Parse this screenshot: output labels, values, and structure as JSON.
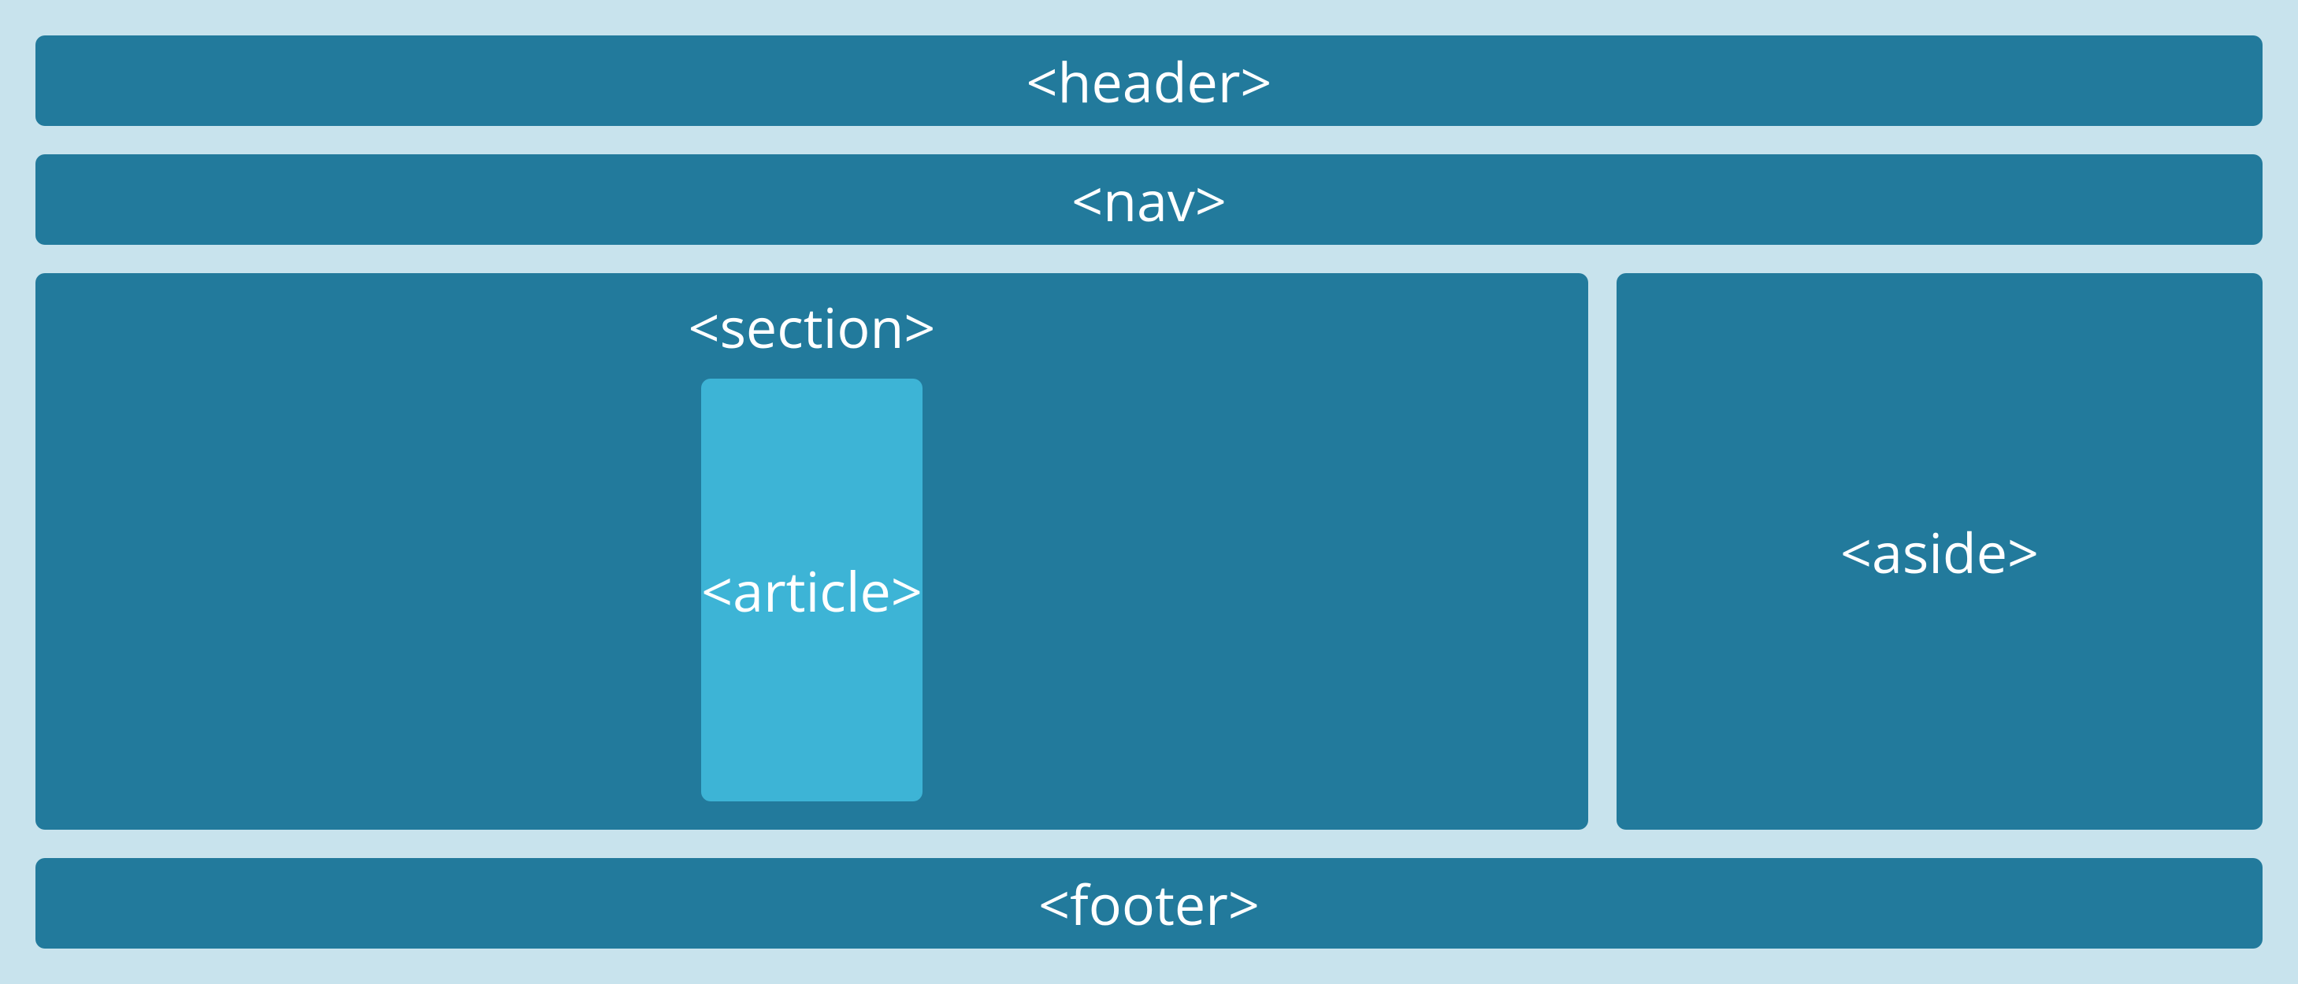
{
  "layout": {
    "header": "<header>",
    "nav": "<nav>",
    "section": "<section>",
    "article": "<article>",
    "aside": "<aside>",
    "footer": "<footer>"
  }
}
